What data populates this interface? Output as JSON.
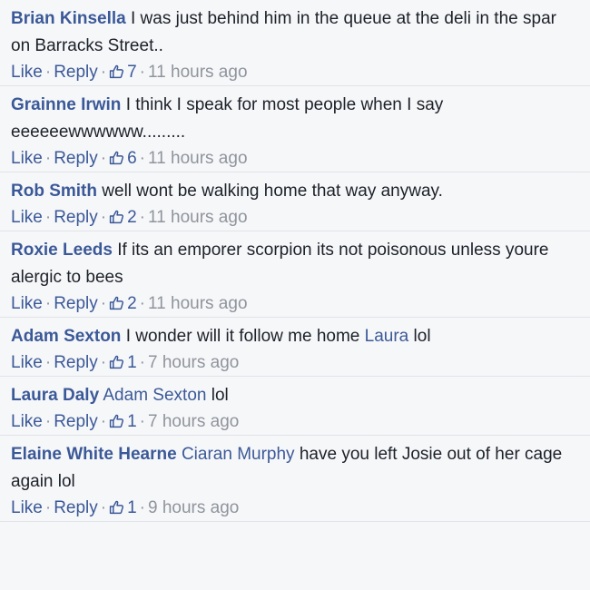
{
  "comments": [
    {
      "author": "Brian Kinsella",
      "mention": "",
      "text": " I was just behind him in the queue at the deli in the spar on Barracks Street..",
      "mention2": "",
      "text2": "",
      "like_label": "Like",
      "reply_label": "Reply",
      "likes": "7",
      "time": "11 hours ago"
    },
    {
      "author": "Grainne Irwin",
      "mention": "",
      "text": " I think I speak for most people when I say eeeeeewwwwww.........",
      "mention2": "",
      "text2": "",
      "like_label": "Like",
      "reply_label": "Reply",
      "likes": "6",
      "time": "11 hours ago"
    },
    {
      "author": "Rob Smith",
      "mention": "",
      "text": " well wont be walking home that way anyway.",
      "mention2": "",
      "text2": "",
      "like_label": "Like",
      "reply_label": "Reply",
      "likes": "2",
      "time": "11 hours ago"
    },
    {
      "author": "Roxie Leeds",
      "mention": "",
      "text": " If its an emporer scorpion its not poisonous unless youre alergic to bees",
      "mention2": "",
      "text2": "",
      "like_label": "Like",
      "reply_label": "Reply",
      "likes": "2",
      "time": "11 hours ago"
    },
    {
      "author": "Adam Sexton",
      "mention": "",
      "text": " I wonder will it follow me home ",
      "mention2": "Laura",
      "text2": " lol",
      "like_label": "Like",
      "reply_label": "Reply",
      "likes": "1",
      "time": "7 hours ago"
    },
    {
      "author": "Laura Daly",
      "mention": " Adam Sexton",
      "text": " lol",
      "mention2": "",
      "text2": "",
      "like_label": "Like",
      "reply_label": "Reply",
      "likes": "1",
      "time": "7 hours ago"
    },
    {
      "author": "Elaine White Hearne",
      "mention": " Ciaran Murphy",
      "text": " have you left Josie out of her cage again lol",
      "mention2": "",
      "text2": "",
      "like_label": "Like",
      "reply_label": "Reply",
      "likes": "1",
      "time": "9 hours ago"
    }
  ],
  "icons": {
    "like_count": "thumbs-up-icon"
  },
  "colors": {
    "link": "#3b5998",
    "meta": "#90949c",
    "text": "#1d2129",
    "background": "#f6f7f9"
  }
}
